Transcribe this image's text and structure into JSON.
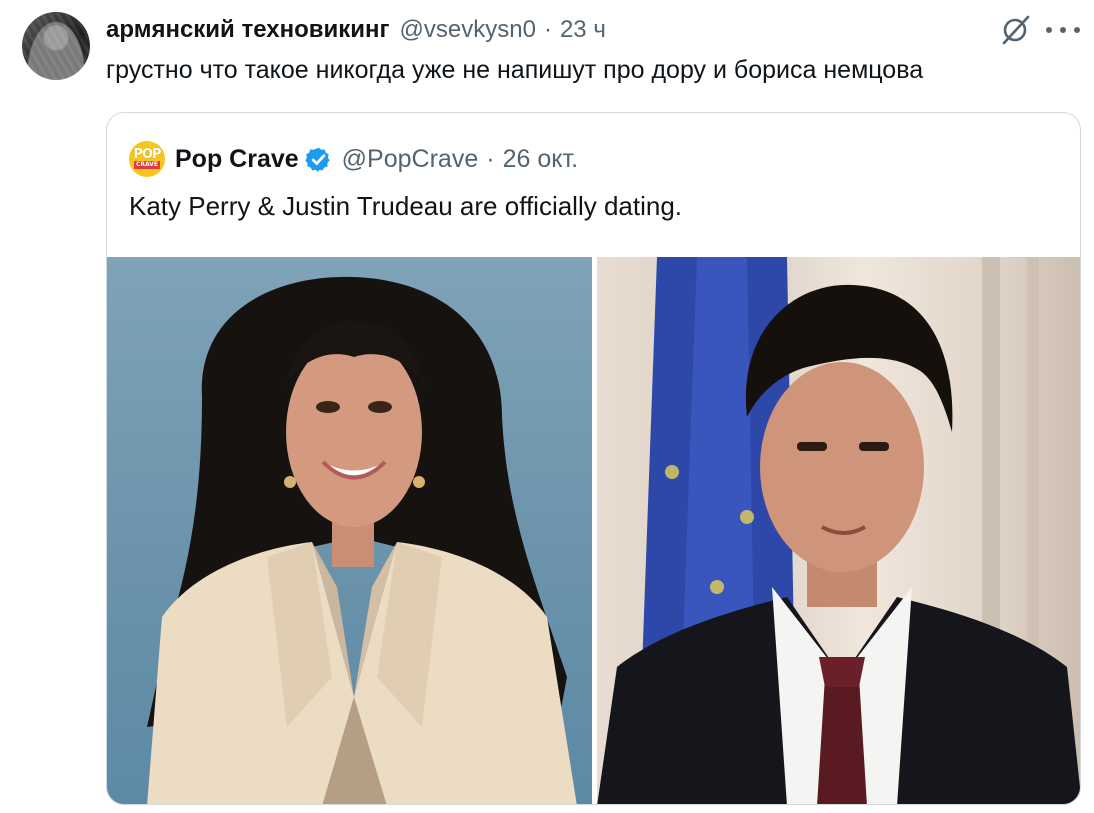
{
  "tweet": {
    "author_name": "армянский техновикинг",
    "author_handle": "@vsevkysn0",
    "separator": "·",
    "time": "23 ч",
    "text": "грустно что такое никогда уже не напишут про дору и бориса немцова",
    "icons": {
      "avatar": "avatar",
      "grok": "grok-icon",
      "more": "more-icon"
    }
  },
  "quote": {
    "logo_text_top": "POP",
    "logo_text_bottom": "CRAVE",
    "author_name": "Pop Crave",
    "author_handle": "@PopCrave",
    "separator": "·",
    "time": "26 окт.",
    "text": "Katy Perry & Justin Trudeau are officially dating.",
    "verified_color": "#1d9bf0",
    "logo_color": "#f7c61c"
  }
}
